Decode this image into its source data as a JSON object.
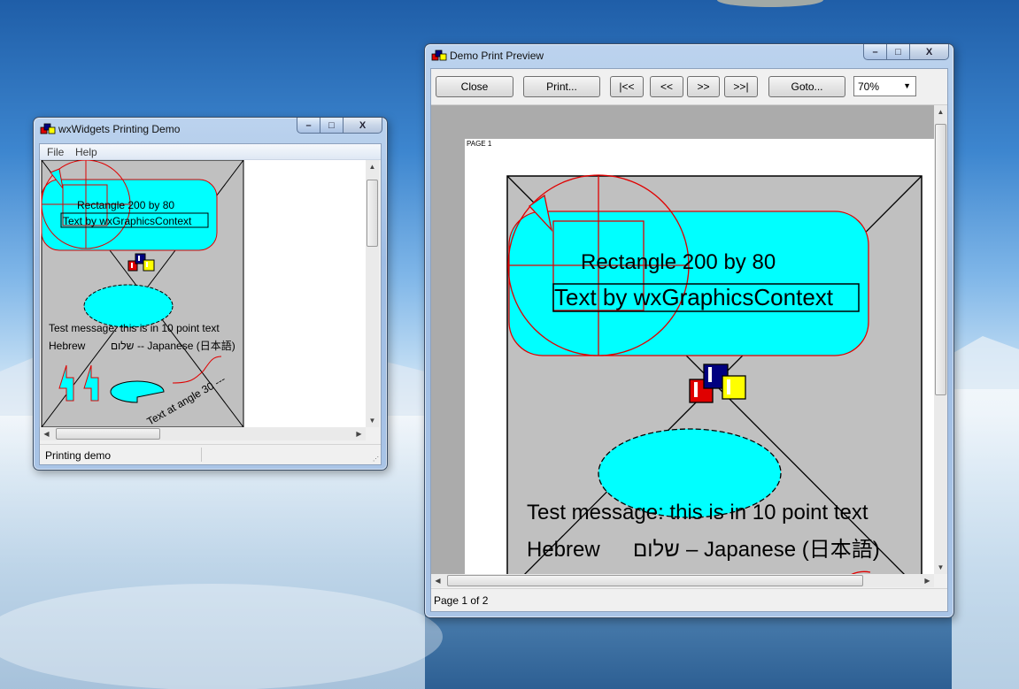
{
  "desktop": {
    "background": "blue sky over waterfall"
  },
  "demo_window": {
    "title": "wxWidgets Printing Demo",
    "icon": "colored-squares-icon",
    "menu": [
      "File",
      "Help"
    ],
    "status": "Printing demo",
    "caption_buttons": {
      "minimize": "–",
      "maximize": "□",
      "close": "X"
    }
  },
  "preview_window": {
    "title": "Demo Print Preview",
    "icon": "colored-squares-icon",
    "toolbar": {
      "close": "Close",
      "print": "Print...",
      "first": "|<<",
      "prev": "<<",
      "next": ">>",
      "last": ">>|",
      "goto": "Goto...",
      "zoom": "70%"
    },
    "page_label": "PAGE 1",
    "status": "Page 1 of 2",
    "caption_buttons": {
      "minimize": "–",
      "maximize": "□",
      "close": "X"
    }
  },
  "drawing": {
    "rect_text": "Rectangle 200 by 80",
    "gc_text": "Text by wxGraphicsContext",
    "test_message": "Test message: this is in 10 point text",
    "hebrew_label": "Hebrew",
    "hebrew_text": "שלום",
    "japanese_text": "-- Japanese (日本語)",
    "japanese_text_preview": "– Japanese (日本語)",
    "angle_text": "Text at angle 30 ---",
    "colors": {
      "cyan": "#00ffff",
      "red": "#ff0000",
      "gray": "#c0c0c0",
      "navy": "#000080",
      "yellow": "#ffff00"
    }
  }
}
